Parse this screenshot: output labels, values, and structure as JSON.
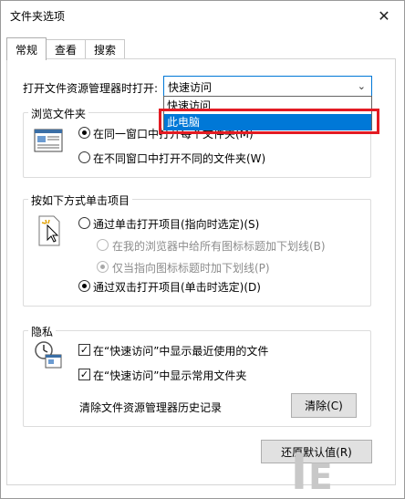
{
  "window": {
    "title": "文件夹选项",
    "close_glyph": "✕"
  },
  "tabs": [
    {
      "label": "常规"
    },
    {
      "label": "查看"
    },
    {
      "label": "搜索"
    }
  ],
  "open_in": {
    "label": "打开文件资源管理器时打开:",
    "value": "快速访问",
    "options": [
      "快速访问",
      "此电脑"
    ],
    "highlighted_option": "此电脑"
  },
  "browse": {
    "title": "浏览文件夹",
    "opt_same": "在同一窗口中打开每个文件夹(M)",
    "opt_new": "在不同窗口中打开不同的文件夹(W)"
  },
  "click": {
    "title": "按如下方式单击项目",
    "opt_single": "通过单击打开项目(指向时选定)(S)",
    "opt_underline_all": "在我的浏览器中给所有图标标题加下划线(B)",
    "opt_underline_hover": "仅当指向图标标题时加下划线(P)",
    "opt_double": "通过双击打开项目(单击时选定)(D)"
  },
  "privacy": {
    "title": "隐私",
    "show_recent": "在“快速访问”中显示最近使用的文件",
    "show_frequent": "在“快速访问”中显示常用文件夹",
    "clear_label": "清除文件资源管理器历史记录",
    "clear_button": "清除(C)"
  },
  "restore_button": "还原默认值(R)",
  "watermark": {
    "text": "lᴇ"
  },
  "colors": {
    "accent": "#0078d7",
    "highlight_border": "#e31b23"
  }
}
